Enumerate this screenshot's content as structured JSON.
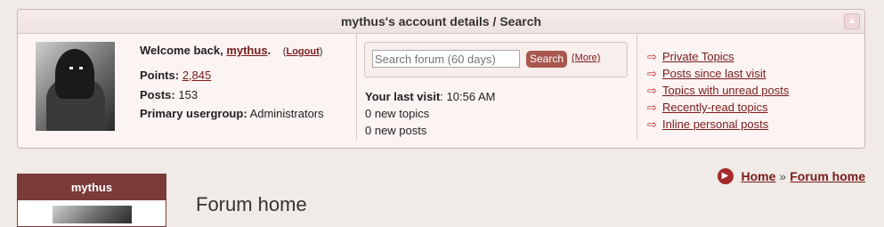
{
  "account": {
    "title": "mythus's account details / Search",
    "collapse_icon": "▲",
    "welcome_prefix": "Welcome back, ",
    "username": "mythus",
    "welcome_suffix": ".",
    "logout_open": "(",
    "logout_label": "Logout",
    "logout_close": ")",
    "points_label": "Points:",
    "points_value": "2,845",
    "posts_label": "Posts:",
    "posts_value": "153",
    "group_label": "Primary usergroup:",
    "group_value": "Administrators"
  },
  "search": {
    "placeholder": "Search forum (60 days)",
    "button_label": "Search",
    "more_label": "(More)"
  },
  "visit": {
    "label": "Your last visit",
    "value": ": 10:56 AM",
    "new_topics": "0 new topics",
    "new_posts": "0 new posts"
  },
  "quick_links": [
    {
      "label": "Private Topics"
    },
    {
      "label": "Posts since last visit"
    },
    {
      "label": "Topics with unread posts"
    },
    {
      "label": "Recently-read topics"
    },
    {
      "label": "Inline personal posts"
    }
  ],
  "profile": {
    "name": "mythus"
  },
  "breadcrumb": {
    "home": "Home",
    "sep": "»",
    "current": "Forum home"
  },
  "page": {
    "title": "Forum home"
  },
  "colors": {
    "accent": "#7b3b38",
    "link": "#7a1a1a",
    "arrow": "#c0303a"
  }
}
